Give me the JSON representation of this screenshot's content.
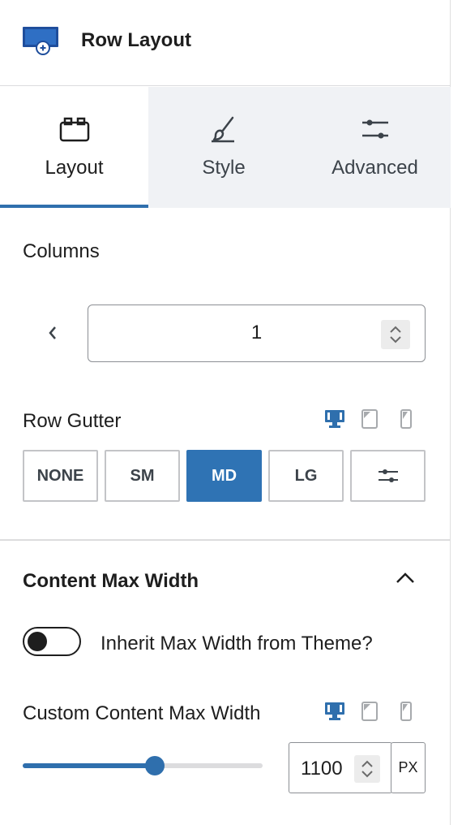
{
  "header": {
    "title": "Row Layout",
    "icon": "row-layout-block-icon"
  },
  "tabs": [
    {
      "label": "Layout",
      "icon": "layout-icon",
      "active": true
    },
    {
      "label": "Style",
      "icon": "brush-icon",
      "active": false
    },
    {
      "label": "Advanced",
      "icon": "sliders-icon",
      "active": false
    }
  ],
  "columns": {
    "label": "Columns",
    "value": "1"
  },
  "row_gutter": {
    "label": "Row Gutter",
    "options": [
      "NONE",
      "SM",
      "MD",
      "LG"
    ],
    "selected": "MD",
    "custom_icon": "sliders-icon"
  },
  "content_max_width": {
    "title": "Content Max Width",
    "inherit_label": "Inherit Max Width from Theme?",
    "inherit_enabled": false,
    "custom_label": "Custom Content Max Width",
    "value": "1100",
    "unit": "PX",
    "slider_fraction": 0.55
  },
  "colors": {
    "accent": "#2f6fad",
    "active_button": "#2f73b4",
    "tab_bg": "#f0f2f5"
  }
}
